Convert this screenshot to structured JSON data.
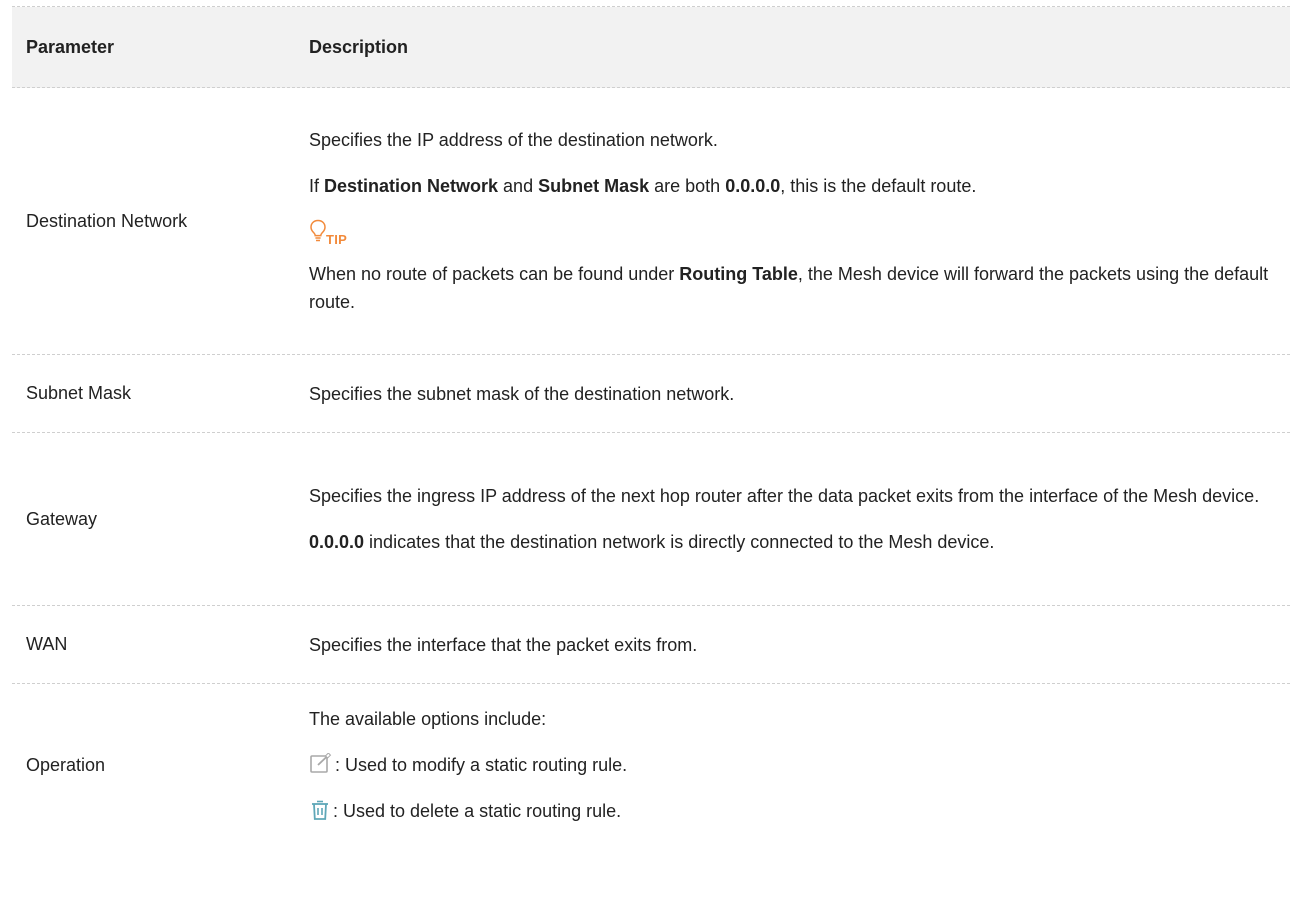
{
  "table": {
    "header": {
      "parameter": "Parameter",
      "description": "Description"
    },
    "rows": {
      "destination": {
        "param": "Destination Network",
        "p1": "Specifies the IP address of the destination network.",
        "p2": {
          "if": "If ",
          "dest": "Destination Network",
          "and": " and ",
          "mask": "Subnet Mask",
          "are": " are both ",
          "zero": "0.0.0.0",
          "tail": ", this is the default route."
        },
        "tip_label": "TIP",
        "tip": {
          "pre": "When no route of packets can be found under ",
          "bold": "Routing Table",
          "post": ", the Mesh device will forward the packets using the default route."
        }
      },
      "subnet": {
        "param": "Subnet Mask",
        "desc": "Specifies the subnet mask of the destination network."
      },
      "gateway": {
        "param": "Gateway",
        "p1": "Specifies the ingress IP address of the next hop router after the data packet exits from the interface of the Mesh device.",
        "p2_bold": "0.0.0.0",
        "p2_rest": " indicates that the destination network is directly connected to the Mesh device."
      },
      "wan": {
        "param": "WAN",
        "desc": "Specifies the interface that the packet exits from."
      },
      "operation": {
        "param": "Operation",
        "p1": "The available options include:",
        "edit_text": ": Used to modify a static routing rule.",
        "delete_text": ": Used to delete a static routing rule.",
        "edit_icon": "edit-icon",
        "delete_icon": "trash-icon"
      }
    }
  },
  "colors": {
    "tip_accent": "#f28a3b",
    "icon_gray": "#a9a9a9",
    "delete_teal": "#5ea7b8"
  }
}
